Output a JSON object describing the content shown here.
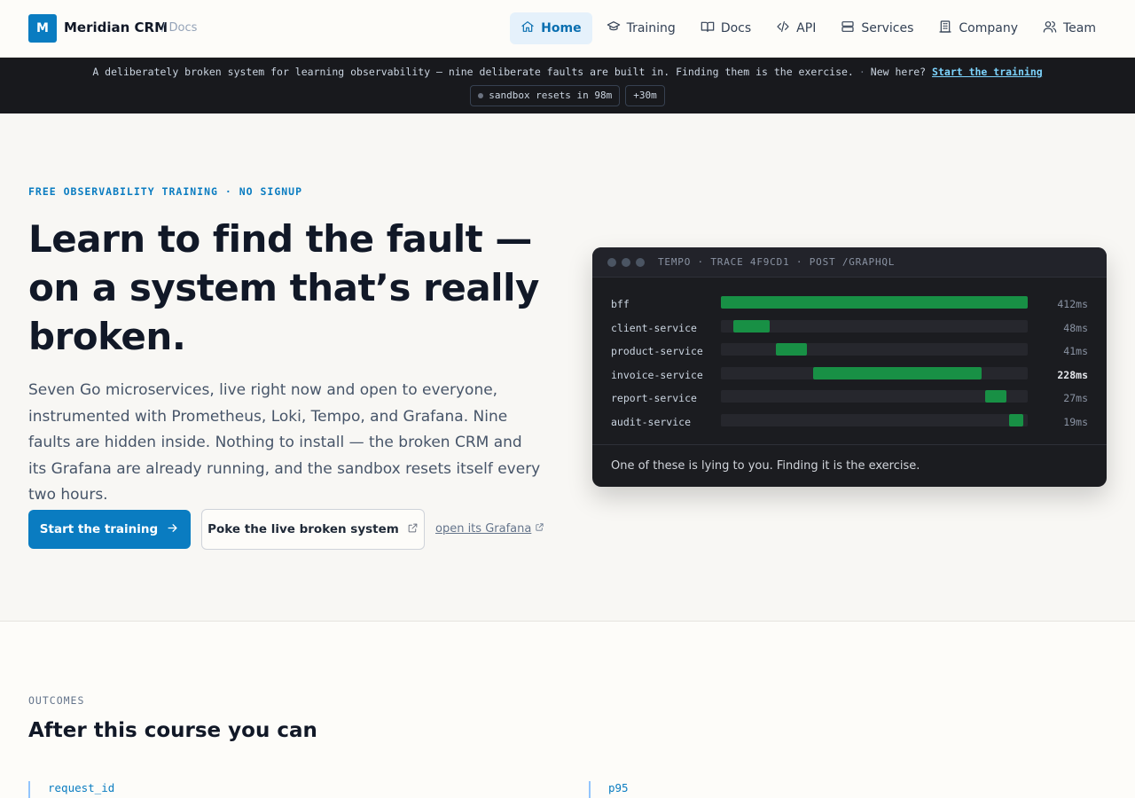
{
  "header": {
    "logo_letter": "M",
    "brand": "Meridian CRM",
    "brand_sub": "/ Docs",
    "nav": [
      {
        "label": "Home",
        "icon": "home-icon"
      },
      {
        "label": "Training",
        "icon": "graduation-cap-icon"
      },
      {
        "label": "Docs",
        "icon": "book-icon"
      },
      {
        "label": "API",
        "icon": "code-icon"
      },
      {
        "label": "Services",
        "icon": "server-icon"
      },
      {
        "label": "Company",
        "icon": "building-icon"
      },
      {
        "label": "Team",
        "icon": "users-icon"
      }
    ],
    "active_nav": "Home"
  },
  "banner": {
    "text": "A deliberately broken system for learning observability — nine deliberate faults are built in. Finding them is the exercise.",
    "separator": "·",
    "new_here": "New here?",
    "cta_link": "Start the training",
    "sandbox_pill": "sandbox resets in 98m",
    "extend_pill": "+30m"
  },
  "hero": {
    "eyebrow": "FREE OBSERVABILITY TRAINING · NO SIGNUP",
    "headline": "Learn to find the fault — on a system that’s really broken.",
    "lead": "Seven Go microservices, live right now and open to everyone, instrumented with Prometheus, Loki, Tempo, and Grafana. Nine faults are hidden inside. Nothing to install — the broken CRM and its Grafana are already running, and the sandbox resets itself every two hours.",
    "primary_button": "Start the training",
    "secondary_button": "Poke the live broken system",
    "grafana_link": "open its Grafana"
  },
  "trace": {
    "title": "TEMPO · TRACE 4F9CD1 · POST /GRAPHQL",
    "spans": [
      {
        "name": "bff",
        "duration": "412ms",
        "start": 0.0,
        "length": 1.0,
        "emphasis": false
      },
      {
        "name": "client-service",
        "duration": "48ms",
        "start": 0.04,
        "length": 0.12,
        "emphasis": false
      },
      {
        "name": "product-service",
        "duration": "41ms",
        "start": 0.18,
        "length": 0.1,
        "emphasis": false
      },
      {
        "name": "invoice-service",
        "duration": "228ms",
        "start": 0.3,
        "length": 0.55,
        "emphasis": true
      },
      {
        "name": "report-service",
        "duration": "27ms",
        "start": 0.86,
        "length": 0.07,
        "emphasis": false
      },
      {
        "name": "audit-service",
        "duration": "19ms",
        "start": 0.94,
        "length": 0.045,
        "emphasis": false
      }
    ],
    "footer": "One of these is lying to you. Finding it is the exercise."
  },
  "outcomes": {
    "eyebrow": "OUTCOMES",
    "title": "After this course you can",
    "terms": [
      "request_id",
      "p95"
    ]
  }
}
